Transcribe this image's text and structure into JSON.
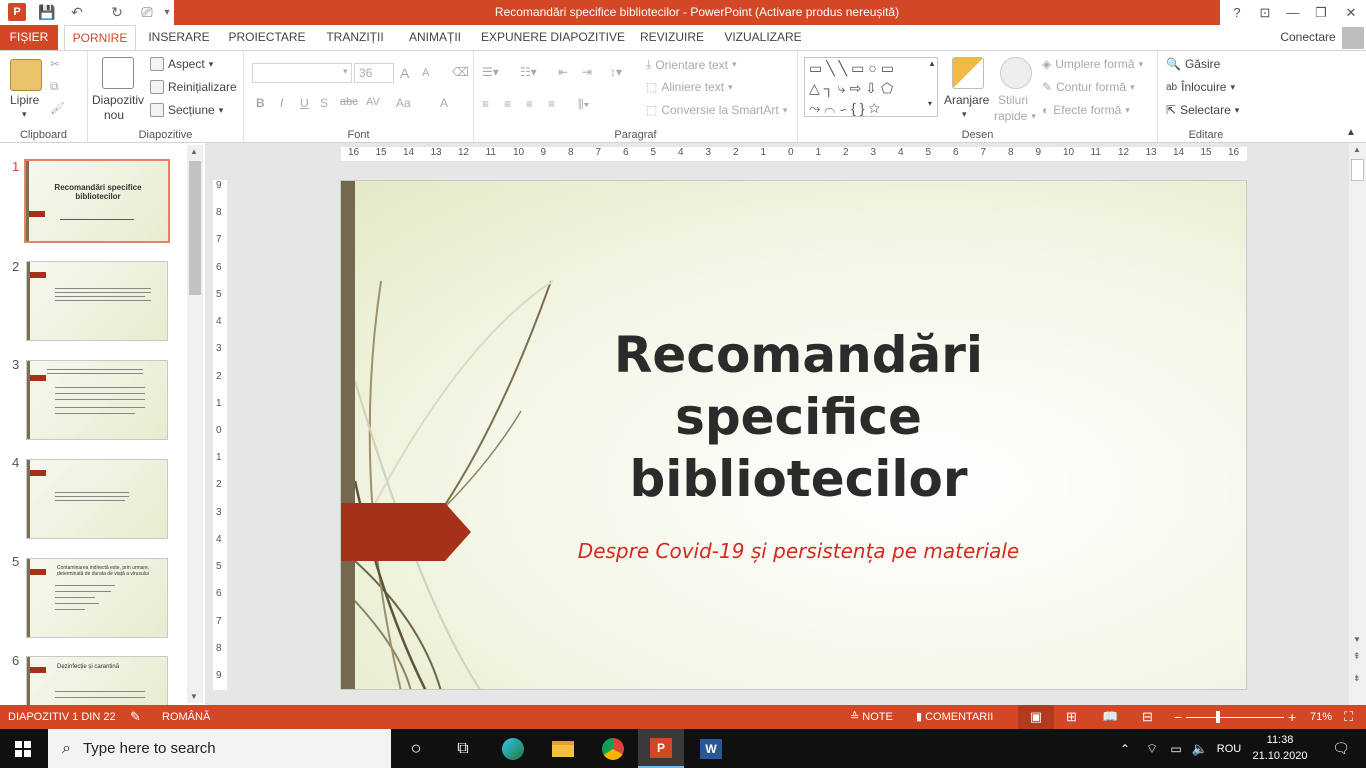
{
  "window": {
    "title": "Recomandări specifice bibliotecilor - PowerPoint (Activare produs nereușită)",
    "help": "?",
    "controls": {
      "minimize": "—",
      "restore": "❐",
      "close": "✕"
    }
  },
  "tabs": [
    {
      "id": "file",
      "label": "FIȘIER"
    },
    {
      "id": "home",
      "label": "PORNIRE"
    },
    {
      "id": "insert",
      "label": "INSERARE"
    },
    {
      "id": "design",
      "label": "PROIECTARE"
    },
    {
      "id": "transitions",
      "label": "TRANZIȚII"
    },
    {
      "id": "animations",
      "label": "ANIMAȚII"
    },
    {
      "id": "slideshow",
      "label": "EXPUNERE DIAPOZITIVE"
    },
    {
      "id": "review",
      "label": "REVIZUIRE"
    },
    {
      "id": "view",
      "label": "VIZUALIZARE"
    }
  ],
  "account": {
    "label": "Conectare"
  },
  "ribbon": {
    "clipboard": {
      "paste": "Lipire",
      "group": "Clipboard"
    },
    "slides": {
      "new_slide_1": "Diapozitiv",
      "new_slide_2": "nou",
      "layout": "Aspect",
      "reset": "Reinițializare",
      "section": "Secțiune",
      "group": "Diapozitive"
    },
    "font": {
      "size": "36",
      "bold": "B",
      "italic": "I",
      "underline": "U",
      "shadow": "S",
      "strike": "abc",
      "spacing": "AV",
      "case": "Aa",
      "grow": "A",
      "shrink": "A",
      "color": "A",
      "group": "Font"
    },
    "paragraph": {
      "text_direction": "Orientare text",
      "align_text": "Aliniere text",
      "smartart": "Conversie la SmartArt",
      "group": "Paragraf"
    },
    "drawing": {
      "arrange": "Aranjare",
      "styles_1": "Stiluri",
      "styles_2": "rapide",
      "fill": "Umplere formă",
      "outline": "Contur formă",
      "effects": "Efecte formă",
      "group": "Desen"
    },
    "editing": {
      "find": "Găsire",
      "replace": "Înlocuire",
      "select": "Selectare",
      "group": "Editare"
    }
  },
  "ruler": {
    "h_ticks": [
      "16",
      "15",
      "14",
      "13",
      "12",
      "11",
      "10",
      "9",
      "8",
      "7",
      "6",
      "5",
      "4",
      "3",
      "2",
      "1",
      "0",
      "1",
      "2",
      "3",
      "4",
      "5",
      "6",
      "7",
      "8",
      "9",
      "10",
      "11",
      "12",
      "13",
      "14",
      "15",
      "16"
    ],
    "v_ticks": [
      "9",
      "8",
      "7",
      "6",
      "5",
      "4",
      "3",
      "2",
      "1",
      "0",
      "1",
      "2",
      "3",
      "4",
      "5",
      "6",
      "7",
      "8",
      "9"
    ]
  },
  "thumbnails": [
    {
      "num": "1",
      "title": "Recomandări specifice bibliotecilor"
    },
    {
      "num": "2"
    },
    {
      "num": "3"
    },
    {
      "num": "4"
    },
    {
      "num": "5",
      "title": "Contaminarea indirectă este, prin urmare, determinată de durata de viață a virusului"
    },
    {
      "num": "6",
      "title": "Dezinfecție și carantină"
    }
  ],
  "slide": {
    "title_line1": "Recomandări specifice",
    "title_line2": "bibliotecilor",
    "subtitle": "Despre Covid-19 și persistența pe materiale"
  },
  "status": {
    "slide_counter": "DIAPOZITIV 1 DIN 22",
    "language": "ROMÂNĂ",
    "notes": "NOTE",
    "comments": "COMENTARII",
    "zoom_minus": "−",
    "zoom_plus": "+",
    "zoom": "71%"
  },
  "taskbar": {
    "search_placeholder": "Type here to search",
    "language": "ROU",
    "time": "11:38",
    "date": "21.10.2020"
  },
  "colors": {
    "accent": "#d24726",
    "slide_arrow": "#a5311a",
    "subtitle": "#d42a1e"
  }
}
